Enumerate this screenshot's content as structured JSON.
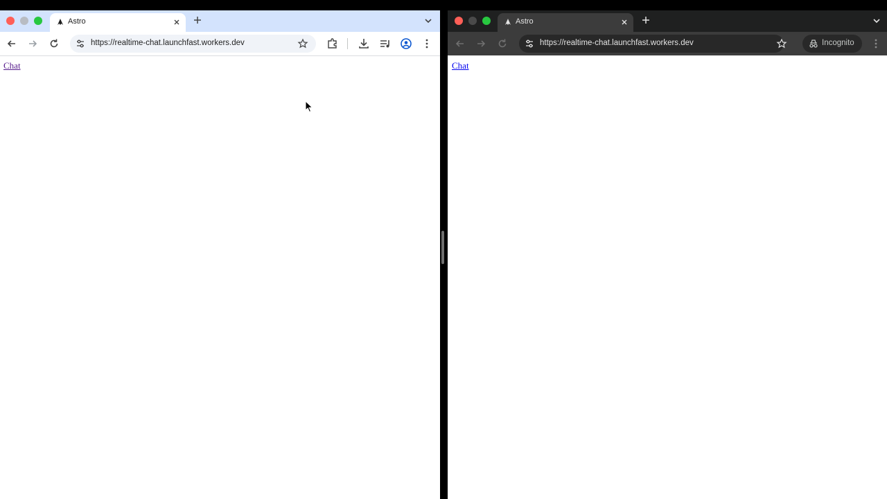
{
  "left_window": {
    "tab_title": "Astro",
    "url": "https://realtime-chat.launchfast.workers.dev",
    "page_link": "Chat"
  },
  "right_window": {
    "tab_title": "Astro",
    "url": "https://realtime-chat.launchfast.workers.dev",
    "incognito_label": "Incognito",
    "page_link": "Chat"
  },
  "colors": {
    "traffic_red": "#ff5f57",
    "traffic_yellow": "#febc2e",
    "traffic_green": "#28c840",
    "light_tabstrip": "#d3e3fd",
    "dark_tabstrip": "#1f2020",
    "visited_link": "#551a8b",
    "unvisited_link": "#0000ee"
  },
  "icons": {
    "favicon": "astro-logo-icon",
    "back": "arrow-left-icon",
    "forward": "arrow-right-icon",
    "reload": "reload-icon",
    "site_info": "tune-icon",
    "bookmark": "star-icon",
    "extensions": "puzzle-icon",
    "downloads": "download-icon",
    "media": "media-queue-icon",
    "profile": "profile-icon",
    "menu": "kebab-menu-icon",
    "incognito": "incognito-icon"
  }
}
